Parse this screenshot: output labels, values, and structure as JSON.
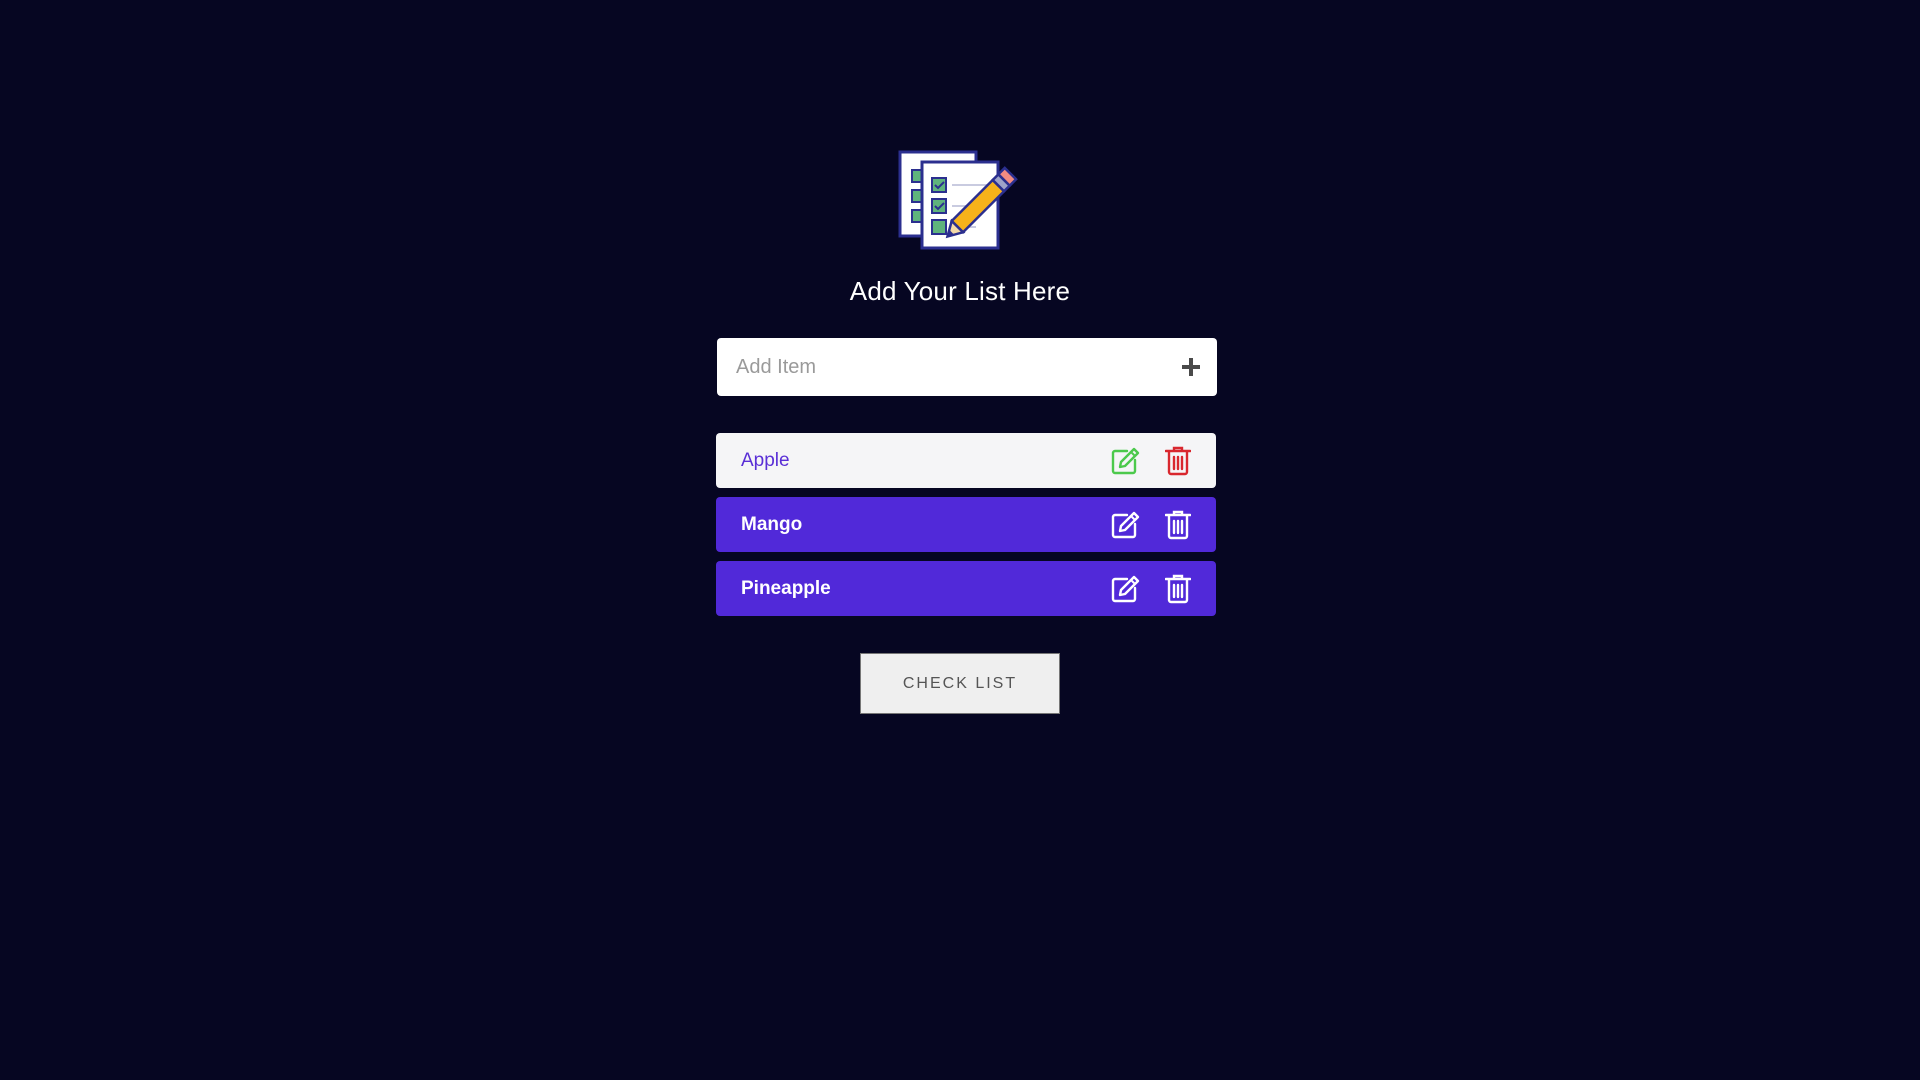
{
  "header": {
    "title": "Add Your List Here",
    "logo_icon": "checklist-pencil-icon"
  },
  "add_item": {
    "placeholder": "Add Item",
    "value": "",
    "add_icon": "plus-icon"
  },
  "items": [
    {
      "label": "Apple",
      "style": "light",
      "edit_icon": "edit-icon",
      "delete_icon": "trash-icon"
    },
    {
      "label": "Mango",
      "style": "purple",
      "edit_icon": "edit-icon",
      "delete_icon": "trash-icon"
    },
    {
      "label": "Pineapple",
      "style": "purple",
      "edit_icon": "edit-icon",
      "delete_icon": "trash-icon"
    }
  ],
  "actions": {
    "check_list_label": "Check List"
  },
  "colors": {
    "background": "#060622",
    "item_purple": "#5129d9",
    "item_light": "#f5f5f7",
    "edit_green": "#4cc94c",
    "delete_red": "#d9272e"
  }
}
